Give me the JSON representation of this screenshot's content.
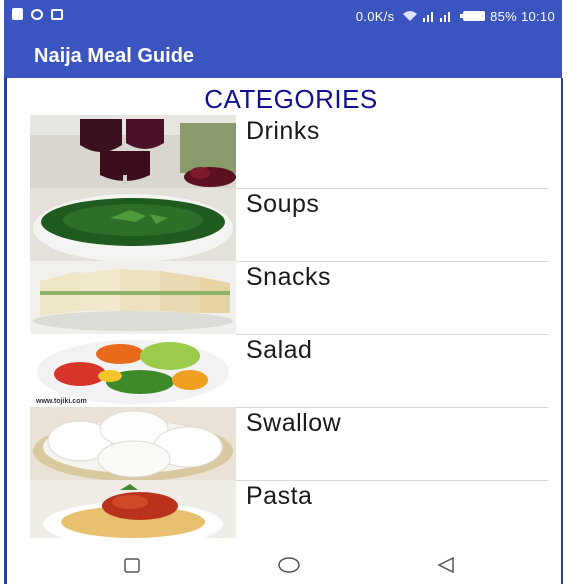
{
  "status_bar": {
    "network_speed": "0.0K/s",
    "battery": "85%",
    "time": "10:10",
    "icons": [
      "facebook-icon",
      "messenger-icon",
      "gallery-icon",
      "wifi-icon",
      "signal-icon",
      "battery-icon"
    ]
  },
  "app_bar": {
    "title": "Naija Meal Guide"
  },
  "main": {
    "heading": "CATEGORIES",
    "categories": [
      {
        "label": "Drinks"
      },
      {
        "label": "Soups"
      },
      {
        "label": "Snacks"
      },
      {
        "label": "Salad"
      },
      {
        "label": "Swallow"
      },
      {
        "label": "Pasta"
      }
    ],
    "salad_watermark": "www.tojiki.com"
  },
  "nav_bar": {
    "buttons": [
      "recents-button",
      "home-button",
      "back-button"
    ]
  },
  "colors": {
    "primary": "#3a54c0",
    "heading": "#11118f"
  }
}
